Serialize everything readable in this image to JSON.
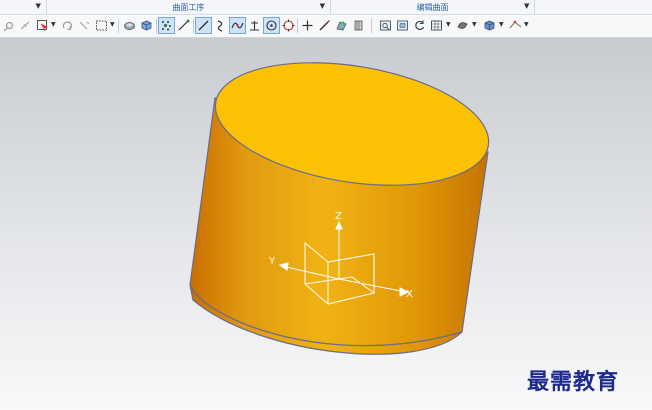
{
  "ribbon": {
    "groups": [
      {
        "label": ""
      },
      {
        "label": "曲面工序"
      },
      {
        "label": "编辑曲面"
      },
      {
        "label": ""
      }
    ]
  },
  "toolbar": {
    "icons": [
      "snap-point-icon",
      "snap-midpoint-icon",
      "select-filter-icon",
      "rotate-icon",
      "select-region-icon",
      "shaded-view-icon",
      "cube-view-icon",
      "point-dots-icon",
      "line-icon",
      "line-tangent-icon",
      "curve-icon",
      "spline-icon",
      "perpendicular-icon",
      "circle-center-icon",
      "circle-icon",
      "plus-icon",
      "pen-icon",
      "render-icon",
      "layer-icon",
      "view-fit-icon",
      "view-frame-icon",
      "refresh-icon",
      "grid-layout-icon",
      "display-mode-icon",
      "cube-shade-icon",
      "wireframe-icon"
    ]
  },
  "viewport": {
    "axes": {
      "x_label": "X",
      "y_label": "Y",
      "z_label": "Z"
    },
    "colors": {
      "cylinder_top": "#fbc204",
      "cylinder_side_light": "#f0b313",
      "cylinder_side_dark": "#c96e00",
      "edge": "#6c6a8d",
      "axis": "#ffffff"
    }
  },
  "watermark": {
    "text": "最需教育"
  }
}
